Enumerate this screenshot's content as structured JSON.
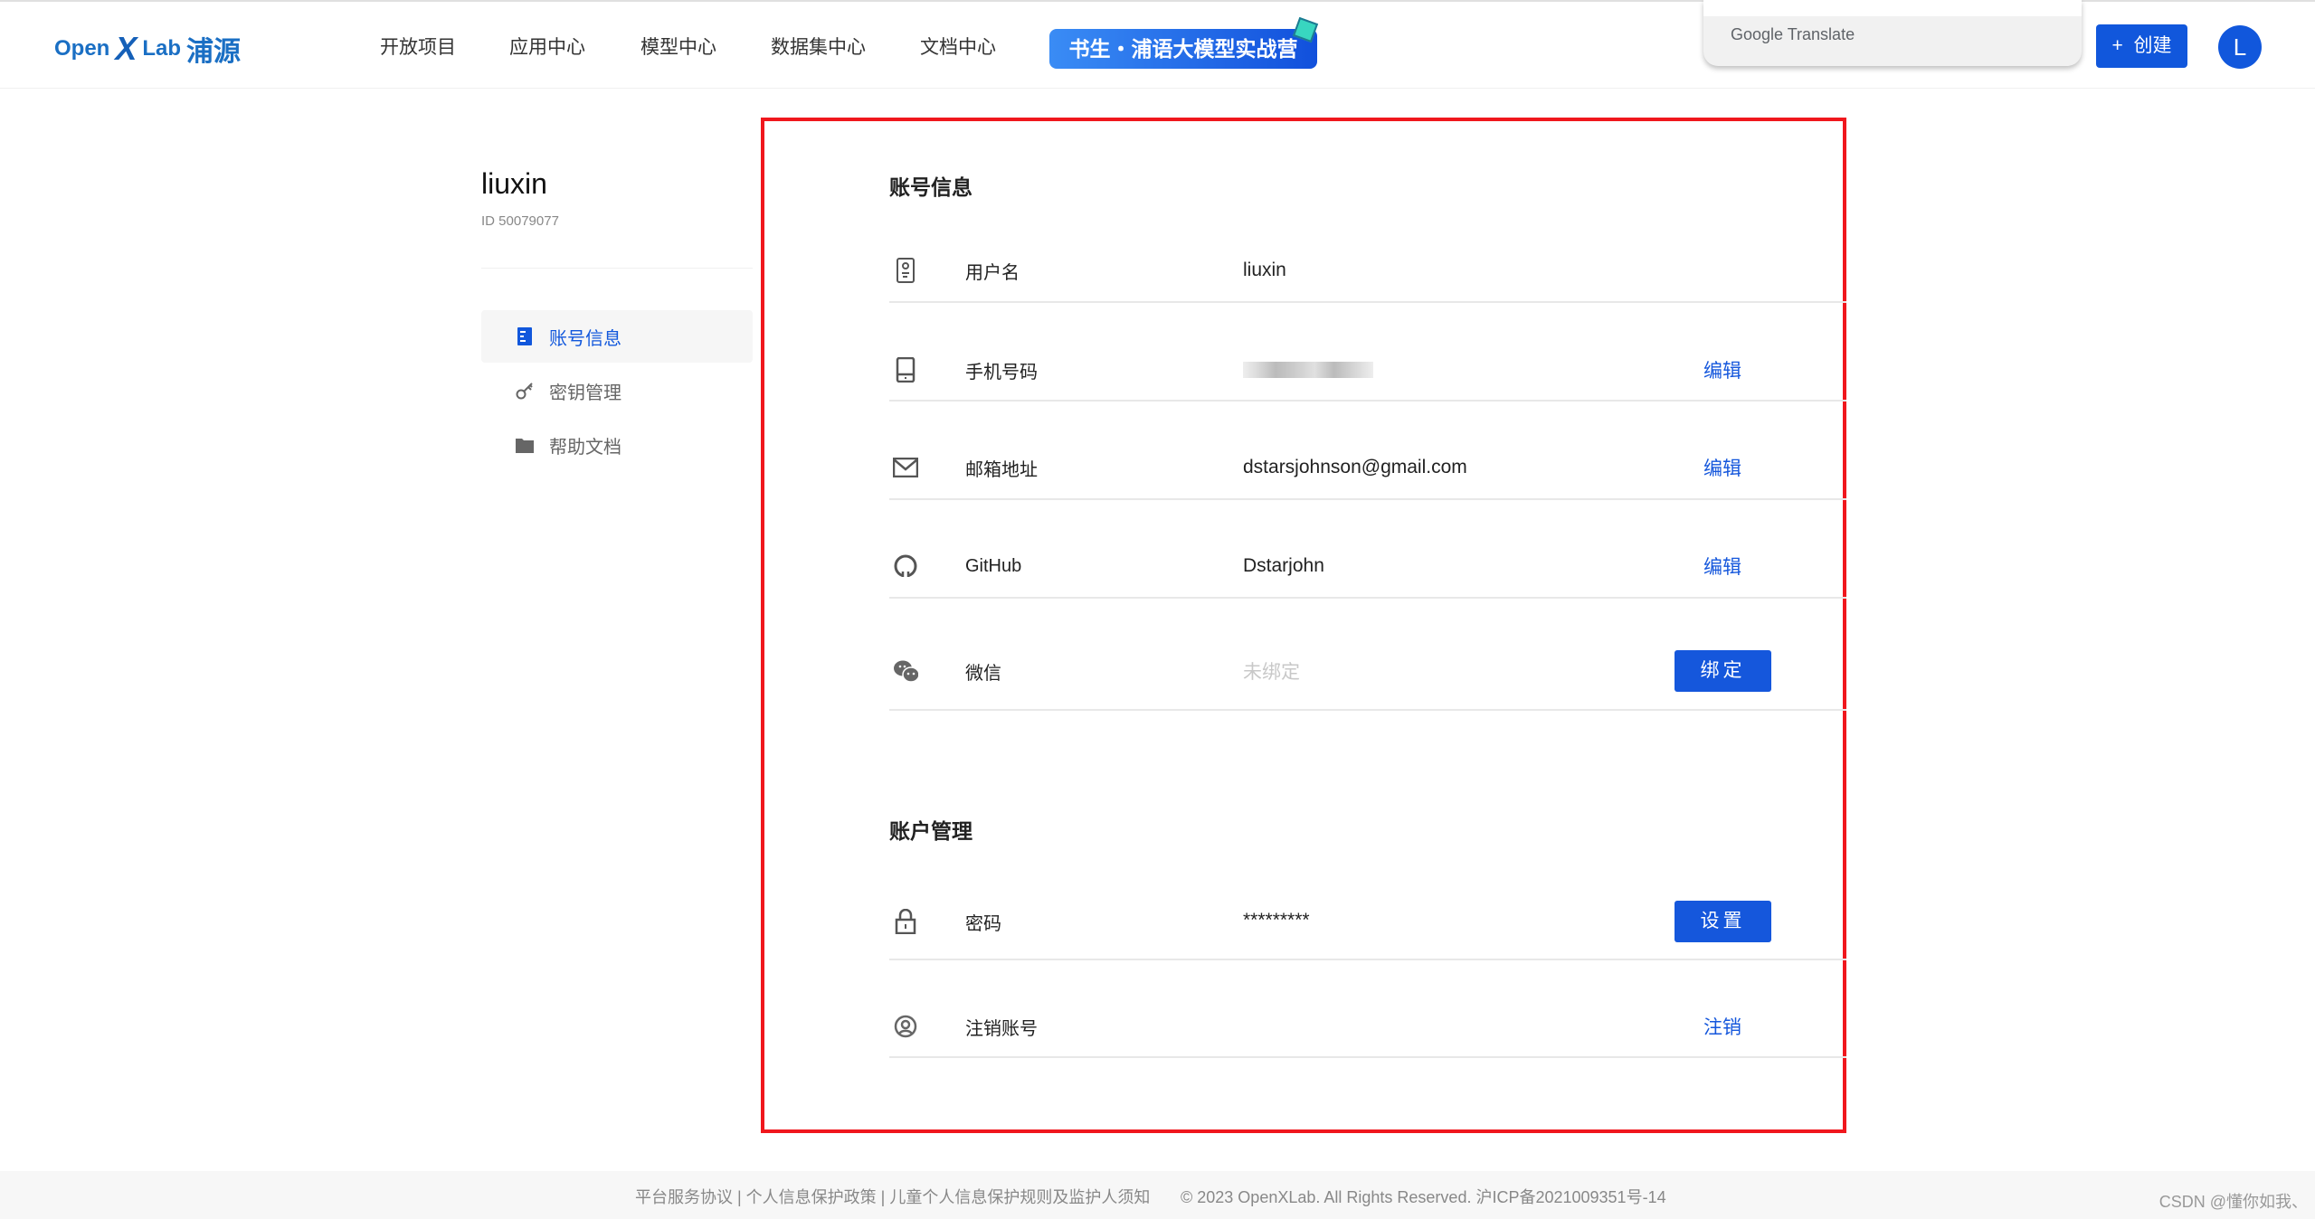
{
  "header": {
    "logo": {
      "open": "Open",
      "x": "X",
      "lab": "Lab",
      "cn": "浦源"
    },
    "nav": [
      "开放项目",
      "应用中心",
      "模型中心",
      "数据集中心",
      "文档中心"
    ],
    "banner": "书生・浦语大模型实战营",
    "google_translate": "Google Translate",
    "create_label": "创建",
    "create_icon": "+",
    "avatar": "L"
  },
  "sidebar": {
    "username": "liuxin",
    "id": "ID 50079077",
    "items": [
      {
        "label": "账号信息",
        "icon": "document-icon",
        "active": true
      },
      {
        "label": "密钥管理",
        "icon": "key-icon"
      },
      {
        "label": "帮助文档",
        "icon": "folder-icon"
      }
    ]
  },
  "account_info": {
    "title": "账号信息",
    "rows": [
      {
        "label": "用户名",
        "value": "liuxin",
        "icon": "id-card-icon"
      },
      {
        "label": "手机号码",
        "value": "",
        "icon": "phone-icon",
        "action": "编辑"
      },
      {
        "label": "邮箱地址",
        "value": "dstarsjohnson@gmail.com",
        "icon": "mail-icon",
        "action": "编辑"
      },
      {
        "label": "GitHub",
        "value": "Dstarjohn",
        "icon": "github-icon",
        "action": "编辑"
      },
      {
        "label": "微信",
        "value": "未绑定",
        "icon": "wechat-icon",
        "button": "绑定"
      }
    ]
  },
  "account_management": {
    "title": "账户管理",
    "rows": [
      {
        "label": "密码",
        "value": "*********",
        "icon": "lock-icon",
        "button": "设置"
      },
      {
        "label": "注销账号",
        "icon": "user-circle-icon",
        "action": "注销"
      }
    ]
  },
  "footer": {
    "links": "平台服务协议 | 个人信息保护政策 | 儿童个人信息保护规则及监护人须知",
    "copyright": "© 2023 OpenXLab. All Rights Reserved. 沪ICP备2021009351号-14",
    "watermark": "CSDN @懂你如我、"
  },
  "colors": {
    "accent": "#1557dc",
    "highlight": "#f0171d"
  }
}
